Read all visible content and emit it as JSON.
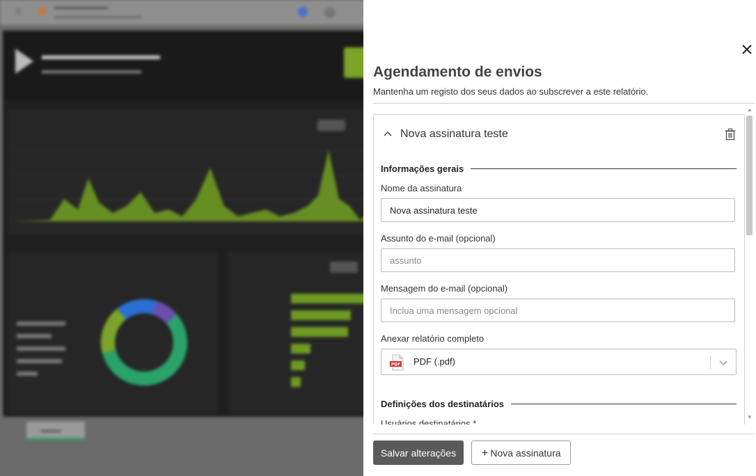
{
  "modal": {
    "title": "Agendamento de envios",
    "subtitle": "Mantenha um registo dos seus dados ao subscrever a este relatório.",
    "subscription": {
      "title": "Nova assinatura teste",
      "general_section": "Informações gerais",
      "name_label": "Nome da assinatura",
      "name_value": "Nova assinatura teste",
      "subject_label": "Assunto do e-mail (opcional)",
      "subject_placeholder": "assunto",
      "message_label": "Mensagem do e-mail (opcional)",
      "message_placeholder": "Inclua uma mensagem opcional",
      "attach_label": "Anexar relatório completo",
      "attach_value": "PDF (.pdf)",
      "recipients_section": "Definições dos destinatários",
      "recipients_label": "Usuários destinatários *"
    },
    "save_label": "Salvar alterações",
    "new_label": "Nova assinatura",
    "close_icon": "close-icon",
    "delete_icon": "trash-icon"
  },
  "colors": {
    "save_button": "#5a5a5a",
    "chart_green": "#7ca32a",
    "accent_teal": "#2aa36b"
  }
}
